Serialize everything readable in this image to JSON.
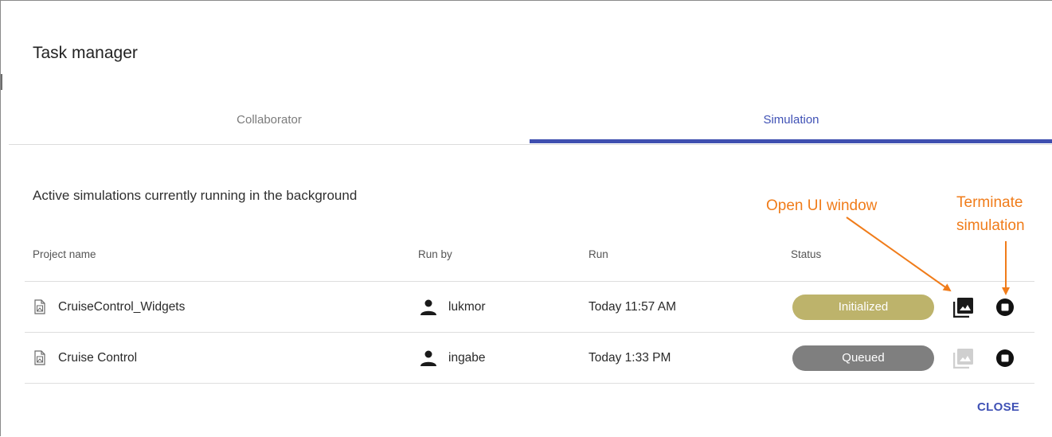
{
  "dialog": {
    "title": "Task manager"
  },
  "tabs": [
    {
      "label": "Collaborator",
      "active": false
    },
    {
      "label": "Simulation",
      "active": true
    }
  ],
  "subtitle": "Active simulations currently running in the background",
  "table": {
    "headers": {
      "project": "Project name",
      "run_by": "Run by",
      "run": "Run",
      "status": "Status"
    },
    "rows": [
      {
        "project": "CruiseControl_Widgets",
        "run_by": "lukmor",
        "run": "Today 11:57 AM",
        "status": "Initialized",
        "status_color": "#bdb36b",
        "ui_window_enabled": true
      },
      {
        "project": "Cruise Control",
        "run_by": "ingabe",
        "run": "Today 1:33 PM",
        "status": "Queued",
        "status_color": "#7f7f7f",
        "ui_window_enabled": false
      }
    ]
  },
  "actions": {
    "close_label": "CLOSE"
  },
  "annotations": {
    "open_ui": "Open UI window",
    "terminate_line1": "Terminate",
    "terminate_line2": "simulation",
    "color": "#f07c1a"
  },
  "colors": {
    "accent": "#3f51b5",
    "tab_indicator": "#3f4fb0"
  },
  "icons": {
    "file": "file-image-icon",
    "person": "person-icon",
    "open_ui": "image-window-icon",
    "terminate": "stop-circle-icon"
  }
}
